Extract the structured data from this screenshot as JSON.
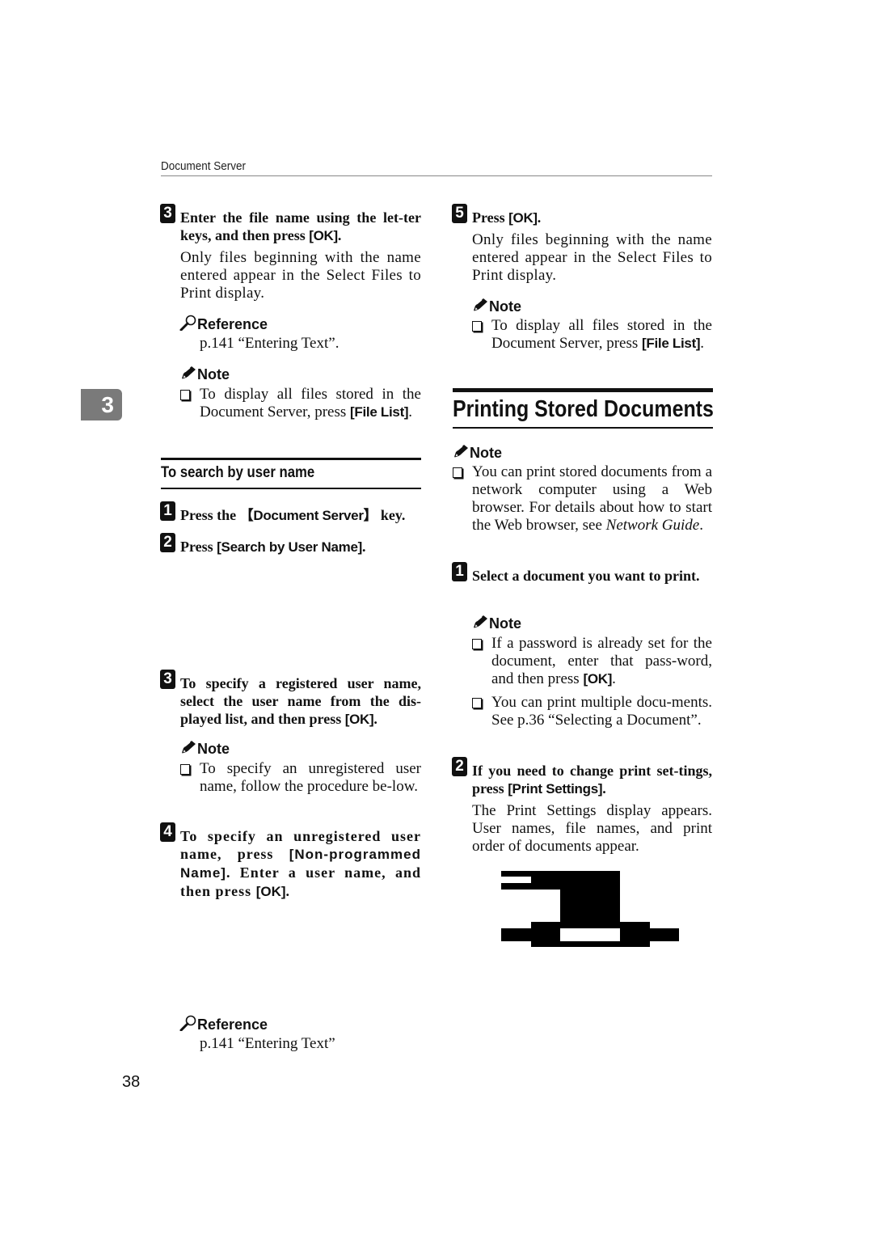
{
  "header": {
    "running_title": "Document Server"
  },
  "chapter_tab": {
    "number": "3"
  },
  "page_number": "38",
  "left_column": {
    "step3": {
      "number": "3",
      "text_before": "Enter the file name using the let-ter keys, and then press ",
      "key": "[OK]",
      "text_after": ".",
      "body": "Only files beginning with the name entered appear in the Select Files to Print display.",
      "reference_label": "Reference",
      "reference_text": "p.141 “Entering Text”.",
      "note_label": "Note",
      "note_text": "To display all files stored in the Document Server, press ",
      "note_key": "[File List]",
      "note_after": "."
    },
    "subsection_title": "To search by user name",
    "sub_step1": {
      "number": "1",
      "text_before": "Press the ",
      "key": "【Document Server】",
      "text_after": " key."
    },
    "sub_step2": {
      "number": "2",
      "text_before": "Press ",
      "key": "[Search by User Name]",
      "text_after": "."
    },
    "sub_step3": {
      "number": "3",
      "text_before": "To specify a registered user name, select the user name from the dis-played list, and then press ",
      "key": "[OK]",
      "text_after": ".",
      "note_label": "Note",
      "note_text": "To specify an unregistered user name, follow the procedure be-low."
    },
    "sub_step4": {
      "number": "4",
      "text_before": "To specify an unregistered user name, press ",
      "key": "[Non-programmed Name]",
      "text_middle": ". Enter a user name, and then press ",
      "key2": "[OK]",
      "text_after": "."
    },
    "reference2_label": "Reference",
    "reference2_text": "p.141 “Entering Text”"
  },
  "right_column": {
    "step5": {
      "number": "5",
      "text_before": "Press ",
      "key": "[OK]",
      "text_after": ".",
      "body": "Only files beginning with the name entered appear in the Select Files to Print display.",
      "note_label": "Note",
      "note_text": "To display all files stored in the Document Server, press ",
      "note_key": "[File List]",
      "note_after": "."
    },
    "section_title": "Printing Stored Documents",
    "section_note_label": "Note",
    "section_note_text": "You can print stored documents from a network computer using a Web browser. For details about how to start the Web browser, see ",
    "section_note_ref": "Network Guide",
    "section_note_after": ".",
    "step1": {
      "number": "1",
      "text": "Select a document you want to print.",
      "note_label": "Note",
      "note1_text": "If a password is already set for the document, enter that pass-word, and then press ",
      "note1_key": "[OK]",
      "note1_after": ".",
      "note2_text": "You can print multiple docu-ments. See p.36 “Selecting a Document”."
    },
    "step2": {
      "number": "2",
      "text_before": "If you need to change print set-tings, press ",
      "key": "[Print Settings]",
      "text_after": ".",
      "body": "The Print Settings display appears. User names, file names, and print order of documents appear."
    }
  }
}
